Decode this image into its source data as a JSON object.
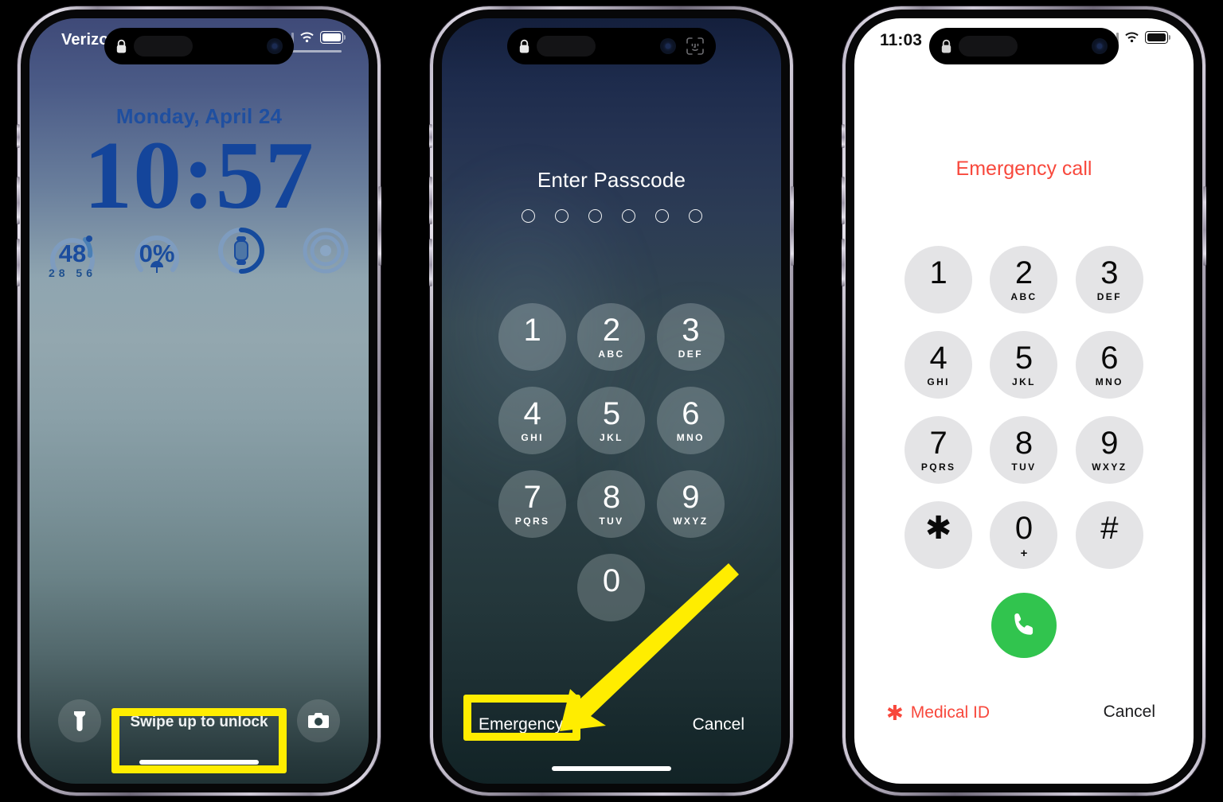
{
  "page": {
    "background_color": "#000000",
    "highlight_color": "#ffed00"
  },
  "phones": [
    {
      "id": "lock-screen",
      "status": {
        "carrier": "Verizon",
        "signal_icon": "cellular-bars-icon",
        "wifi_icon": "wifi-icon",
        "battery_icon": "battery-icon",
        "island_lock_icon": "lock-icon"
      },
      "lock": {
        "date": "Monday, April 24",
        "time": "10:57",
        "widgets": [
          {
            "name": "weather-temperature-widget",
            "value": "48",
            "sub": "28  56",
            "icon": "temperature-arc-icon"
          },
          {
            "name": "precipitation-widget",
            "value": "0%",
            "sub": "",
            "icon": "umbrella-icon"
          },
          {
            "name": "watch-battery-widget",
            "value": "",
            "sub": "",
            "icon": "apple-watch-icon"
          },
          {
            "name": "find-my-widget",
            "value": "",
            "sub": "",
            "icon": "rings-target-icon"
          }
        ],
        "flashlight_icon": "flashlight-icon",
        "camera_icon": "camera-icon",
        "swipe_hint": "Swipe up to unlock"
      }
    },
    {
      "id": "passcode-screen",
      "status": {
        "island_lock_icon": "lock-icon",
        "island_faceid_icon": "face-id-icon"
      },
      "passcode": {
        "title": "Enter Passcode",
        "dot_count": 6,
        "keys": [
          {
            "digit": "1",
            "letters": ""
          },
          {
            "digit": "2",
            "letters": "ABC"
          },
          {
            "digit": "3",
            "letters": "DEF"
          },
          {
            "digit": "4",
            "letters": "GHI"
          },
          {
            "digit": "5",
            "letters": "JKL"
          },
          {
            "digit": "6",
            "letters": "MNO"
          },
          {
            "digit": "7",
            "letters": "PQRS"
          },
          {
            "digit": "8",
            "letters": "TUV"
          },
          {
            "digit": "9",
            "letters": "WXYZ"
          },
          {
            "digit": "0",
            "letters": ""
          }
        ],
        "emergency_label": "Emergency",
        "cancel_label": "Cancel"
      }
    },
    {
      "id": "emergency-dialer",
      "status": {
        "time": "11:03",
        "signal_icon": "cellular-bars-icon",
        "wifi_icon": "wifi-icon",
        "battery_icon": "battery-icon",
        "island_lock_icon": "lock-icon"
      },
      "dialer": {
        "title": "Emergency call",
        "title_color": "#f8483c",
        "keys": [
          {
            "digit": "1",
            "letters": ""
          },
          {
            "digit": "2",
            "letters": "ABC"
          },
          {
            "digit": "3",
            "letters": "DEF"
          },
          {
            "digit": "4",
            "letters": "GHI"
          },
          {
            "digit": "5",
            "letters": "JKL"
          },
          {
            "digit": "6",
            "letters": "MNO"
          },
          {
            "digit": "7",
            "letters": "PQRS"
          },
          {
            "digit": "8",
            "letters": "TUV"
          },
          {
            "digit": "9",
            "letters": "WXYZ"
          },
          {
            "digit": "✱",
            "letters": ""
          },
          {
            "digit": "0",
            "letters": "+"
          },
          {
            "digit": "#",
            "letters": ""
          }
        ],
        "call_button_icon": "phone-handset-icon",
        "call_button_color": "#31c44e",
        "medical_id_label": "Medical ID",
        "medical_id_icon": "medical-star-icon",
        "cancel_label": "Cancel"
      }
    }
  ],
  "annotations": {
    "highlight_swipe_label": "swipe-up-to-unlock-highlight",
    "highlight_emergency_label": "emergency-button-highlight",
    "arrow_label": "pointer-arrow"
  }
}
